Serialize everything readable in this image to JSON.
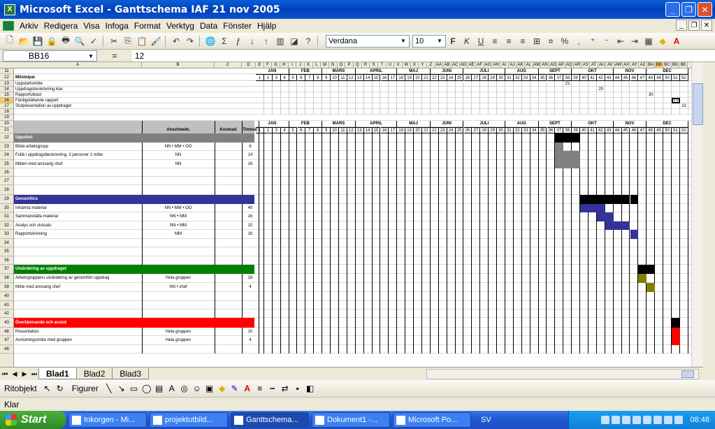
{
  "window": {
    "title": "Microsoft Excel - Ganttschema IAF 21 nov 2005",
    "app_icon": "excel-icon"
  },
  "menu": [
    "Arkiv",
    "Redigera",
    "Visa",
    "Infoga",
    "Format",
    "Verktyg",
    "Data",
    "Fönster",
    "Hjälp"
  ],
  "toolbar": {
    "font": "Verdana",
    "size": "10"
  },
  "formula": {
    "cell_ref": "BB16",
    "eq": "=",
    "value": "12"
  },
  "months": [
    "JAN",
    "FEB",
    "MARS",
    "APRIL",
    "MAJ",
    "JUNI",
    "JULI",
    "AUG",
    "SEPT",
    "OKT",
    "NOV",
    "DEC"
  ],
  "col_letters": [
    "A",
    "B",
    "C",
    "D",
    "E",
    "F",
    "G",
    "H",
    "I",
    "J",
    "K",
    "L",
    "M",
    "N",
    "O",
    "P",
    "Q",
    "R",
    "S",
    "T",
    "U",
    "V",
    "W",
    "X",
    "Y",
    "Z",
    "AA",
    "AB",
    "AC",
    "AD",
    "AE",
    "AF",
    "AG",
    "AH",
    "AI",
    "AJ",
    "AK",
    "AL",
    "AM",
    "AN",
    "AO",
    "AP",
    "AQ",
    "AR",
    "AS",
    "AT",
    "AU",
    "AV",
    "AW",
    "AX",
    "AY",
    "AZ",
    "BA",
    "BB",
    "BC",
    "BD",
    "BE"
  ],
  "headers": {
    "ansv": "Ansv/medv.",
    "kostnad": "Kostnad",
    "timmar": "Timmar"
  },
  "milestones": {
    "title": "Milstolpar",
    "items": [
      {
        "row": "13",
        "label": "Uppstartsmöte",
        "week_label": "21"
      },
      {
        "row": "14",
        "label": "Uppdragsbeskrivning klar",
        "week_label": "20"
      },
      {
        "row": "15",
        "label": "Rapportutkast",
        "week_label": "30"
      },
      {
        "row": "16",
        "label": "Färdigställande rapport",
        "week_label": "12"
      },
      {
        "row": "17",
        "label": "Slutpresentation av uppdraget",
        "week_label": "21"
      }
    ]
  },
  "sections": [
    {
      "row": "22",
      "title": "Uppstart",
      "color": "#808080",
      "bar_color": "#000000",
      "tasks": [
        {
          "row": "23",
          "label": "Bilda arbetsgrupp",
          "ansv": "NN • MM • OO",
          "timmar": "6"
        },
        {
          "row": "24",
          "label": "Fullä i uppdragsbeskrivning, 3 personer 1 möte",
          "ansv": "NN",
          "timmar": "14"
        },
        {
          "row": "25",
          "label": "Möten med ansvarig chef",
          "ansv": "NN",
          "timmar": "16"
        }
      ]
    },
    {
      "row": "29",
      "title": "Genomföra",
      "color": "#333399",
      "bar_color": "#000000",
      "tasks": [
        {
          "row": "30",
          "label": "Inhämta material",
          "ansv": "NN • MM • OO",
          "timmar": "40"
        },
        {
          "row": "31",
          "label": "Sammanställa material",
          "ansv": "NN • MM",
          "timmar": "16"
        },
        {
          "row": "32",
          "label": "Analys och slutsats",
          "ansv": "NN • MM",
          "timmar": "10"
        },
        {
          "row": "33",
          "label": "Rapportskrivning",
          "ansv": "MM",
          "timmar": "16"
        }
      ]
    },
    {
      "row": "37",
      "title": "Utvärdering av uppdraget",
      "color": "#008000",
      "bar_color": "#000000",
      "tasks": [
        {
          "row": "38",
          "label": "Arbetsgruppens utvärdering av genomfört uppdrag",
          "ansv": "Hela gruppen",
          "timmar": "16"
        },
        {
          "row": "39",
          "label": "Möte med ansvarig chef",
          "ansv": "NN • chef",
          "timmar": "4"
        }
      ]
    },
    {
      "row": "43",
      "title": "Överlämnande och avslut",
      "color": "#ff0000",
      "bar_color": "#000000",
      "tasks": [
        {
          "row": "46",
          "label": "Presentation",
          "ansv": "Hela gruppen",
          "timmar": "10"
        },
        {
          "row": "47",
          "label": "Avslutningsmöte med gruppen",
          "ansv": "Hela gruppen",
          "timmar": "4"
        }
      ]
    }
  ],
  "gantt": {
    "uppstart_header": [
      37,
      38,
      39
    ],
    "uppstart_cells": [
      [
        37
      ],
      [
        37,
        38,
        39
      ],
      [
        37,
        38,
        39
      ]
    ],
    "genomfora_header": [
      40,
      41,
      42,
      43,
      44,
      45,
      46
    ],
    "genomfora_cells": [
      [
        40,
        41,
        42
      ],
      [
        42,
        43
      ],
      [
        43,
        44,
        45
      ],
      [
        46
      ]
    ],
    "utv_header": [
      47,
      48
    ],
    "utv_cells": [
      [
        47
      ],
      [
        48
      ]
    ],
    "avslut_header": [
      51
    ],
    "avslut_cells": [
      [
        51
      ],
      [
        51
      ]
    ],
    "colors": {
      "uppstart": "#808080",
      "genomfora": "#333399",
      "utv": "#808000",
      "avslut": "#ff0000"
    }
  },
  "sheets": [
    "Blad1",
    "Blad2",
    "Blad3"
  ],
  "drawing": {
    "ritobjekt": "Ritobjekt",
    "figurer": "Figurer"
  },
  "status": "Klar",
  "taskbar": {
    "start": "Start",
    "tasks": [
      "Inkorgen - Mi...",
      "projektutbild...",
      "Ganttschema...",
      "Dokument1 -...",
      "Microsoft Po..."
    ],
    "active_index": 2,
    "lang": "SV",
    "clock": "08:48"
  }
}
